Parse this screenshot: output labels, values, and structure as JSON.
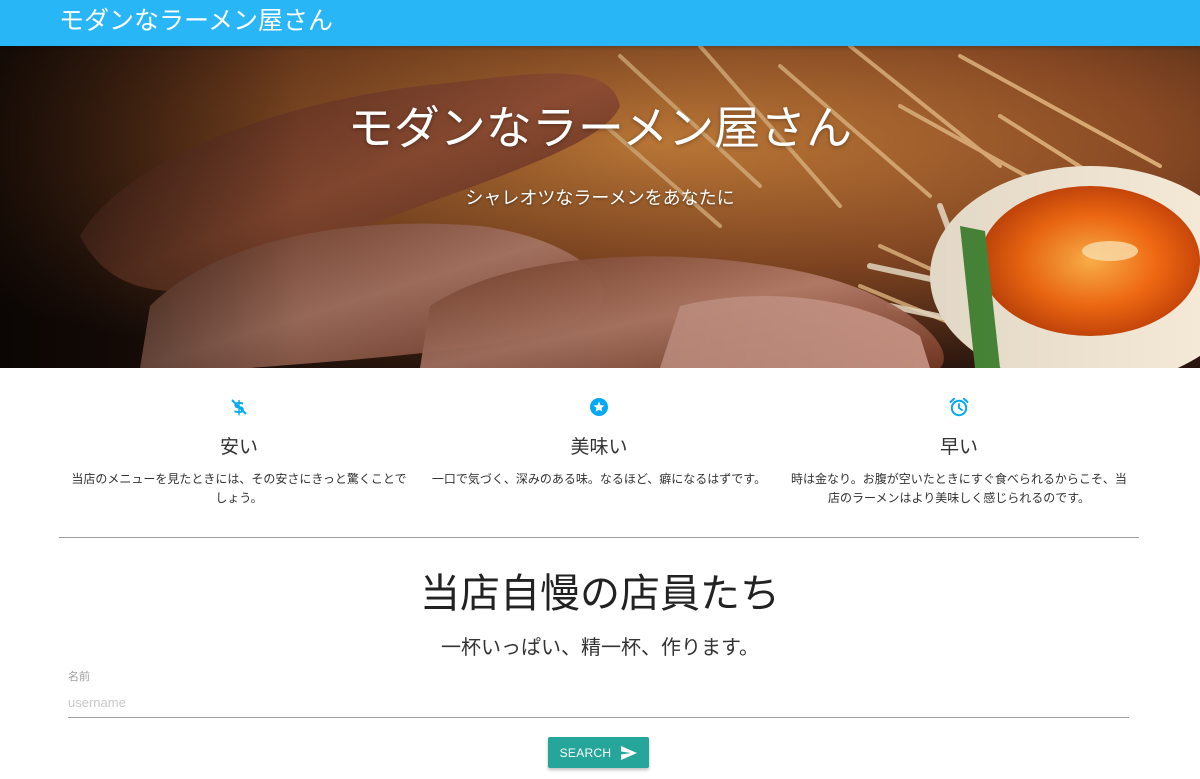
{
  "navbar": {
    "brand": "モダンなラーメン屋さん"
  },
  "hero": {
    "title": "モダンなラーメン屋さん",
    "subtitle": "シャレオツなラーメンをあなたに"
  },
  "features": [
    {
      "icon": "dollar-off-icon",
      "title": "安い",
      "text": "当店のメニューを見たときには、その安さにきっと驚くことでしょう。"
    },
    {
      "icon": "star-circle-icon",
      "title": "美味い",
      "text": "一口で気づく、深みのある味。なるほど、癖になるはずです。"
    },
    {
      "icon": "alarm-clock-icon",
      "title": "早い",
      "text": "時は金なり。お腹が空いたときにすぐ食べられるからこそ、当店のラーメンはより美味しく感じられるのです。"
    }
  ],
  "staff_section": {
    "title": "当店自慢の店員たち",
    "subtitle": "一杯いっぱい、精一杯、作ります。"
  },
  "form": {
    "name_label": "名前",
    "name_placeholder": "username",
    "search_label": "SEARCH"
  },
  "colors": {
    "navbar": "#29b6f6",
    "icon_accent": "#03a9f4",
    "button": "#26a69a"
  }
}
